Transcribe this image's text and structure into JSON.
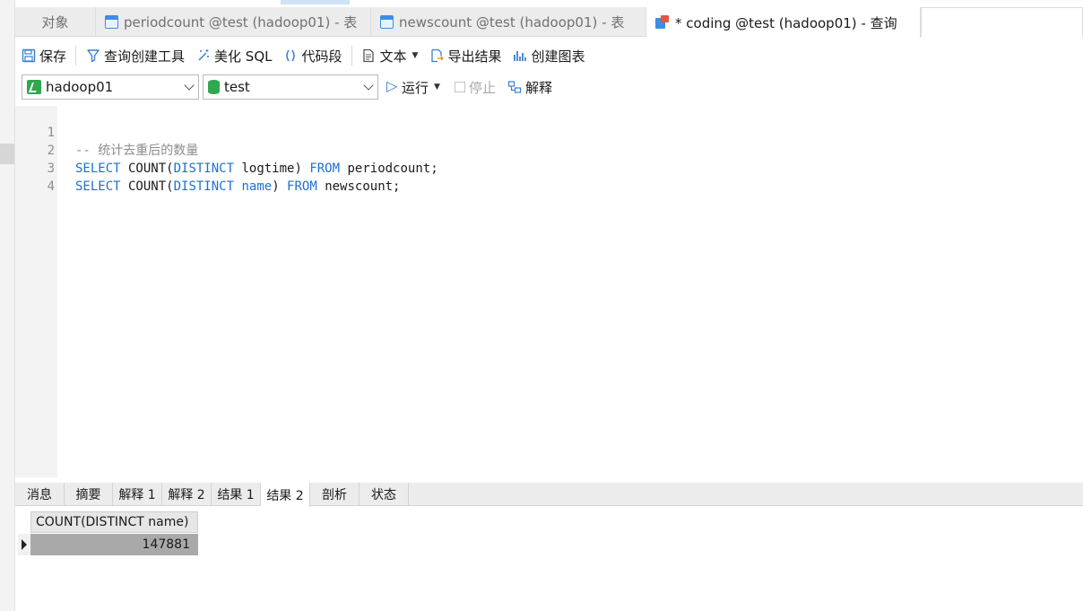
{
  "tabs": [
    {
      "label": "对象",
      "icon": "none"
    },
    {
      "label": "periodcount @test (hadoop01) - 表",
      "icon": "table-icon"
    },
    {
      "label": "newscount @test (hadoop01) - 表",
      "icon": "table-icon"
    },
    {
      "label": "* coding @test (hadoop01) - 查询",
      "icon": "query-icon"
    }
  ],
  "toolbar": {
    "save": "保存",
    "query_builder": "查询创建工具",
    "beautify_sql": "美化 SQL",
    "code_snippet": "代码段",
    "text": "文本",
    "export_result": "导出结果",
    "create_chart": "创建图表"
  },
  "connection": {
    "server": "hadoop01",
    "database": "test",
    "run": "运行",
    "stop": "停止",
    "explain": "解释"
  },
  "editor": {
    "line_numbers": [
      "1",
      "2",
      "3",
      "4"
    ],
    "comment": "-- 统计去重后的数量",
    "line2": {
      "kw1": "SELECT",
      "t1": " COUNT(",
      "kw2": "DISTINCT",
      "t2": " logtime) ",
      "kw3": "FROM",
      "t3": " periodcount;"
    },
    "line3": {
      "kw1": "SELECT",
      "t1": " COUNT(",
      "kw2": "DISTINCT",
      "t2": " ",
      "kw_name": "name",
      "t2b": ") ",
      "kw3": "FROM",
      "t3": " newscount;"
    }
  },
  "result_tabs": [
    "消息",
    "摘要",
    "解释 1",
    "解释 2",
    "结果 1",
    "结果 2",
    "剖析",
    "状态"
  ],
  "result_active_index": 5,
  "result": {
    "column": "COUNT(DISTINCT name)",
    "value": "147881"
  },
  "colors": {
    "keyword": "#1f6fd1",
    "comment": "#8c8c8c",
    "connection_green": "#2fa84f",
    "accent_blue": "#3a8ee6"
  }
}
